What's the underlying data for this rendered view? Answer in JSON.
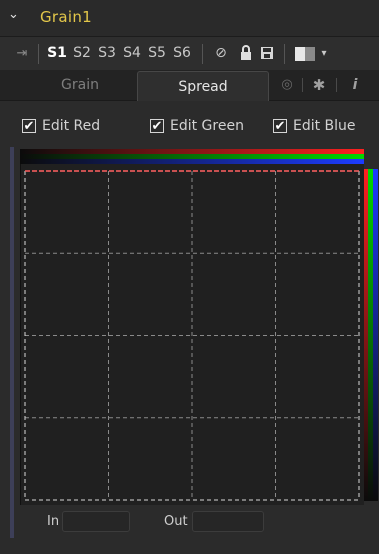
{
  "header": {
    "collapse_glyph": "⌄",
    "title": "Grain1",
    "title_color": "#e3c74a"
  },
  "toolbar": {
    "pin_glyph": "⇥",
    "slots": [
      "S1",
      "S2",
      "S3",
      "S4",
      "S5",
      "S6"
    ],
    "active_slot": "S1",
    "icons": [
      "null-icon",
      "lock-icon",
      "save-icon",
      "color-swatch",
      "chevron-down-icon"
    ],
    "null_glyph": "⊘",
    "lock_glyph": "🔒",
    "save_glyph": "💾",
    "chevron_glyph": "▾"
  },
  "tabs": {
    "items": [
      "Grain",
      "Spread"
    ],
    "active": "Spread",
    "icon_names": [
      "link-icon",
      "gear-icon",
      "info-icon"
    ],
    "link_glyph": "◎",
    "gear_glyph": "✱",
    "info_glyph": "i"
  },
  "checkboxes": {
    "red": {
      "label": "Edit Red",
      "checked": true
    },
    "green": {
      "label": "Edit Green",
      "checked": true
    },
    "blue": {
      "label": "Edit Blue",
      "checked": true
    },
    "check_glyph": "✔"
  },
  "curve_editor": {
    "grid_divisions": 4,
    "ramp_colors": {
      "red": "#ff2020",
      "green": "#00d800",
      "blue": "#1c3cff"
    },
    "curve_color": "#ff6060"
  },
  "in_out": {
    "in_label": "In",
    "in_value": "",
    "out_label": "Out",
    "out_value": ""
  }
}
